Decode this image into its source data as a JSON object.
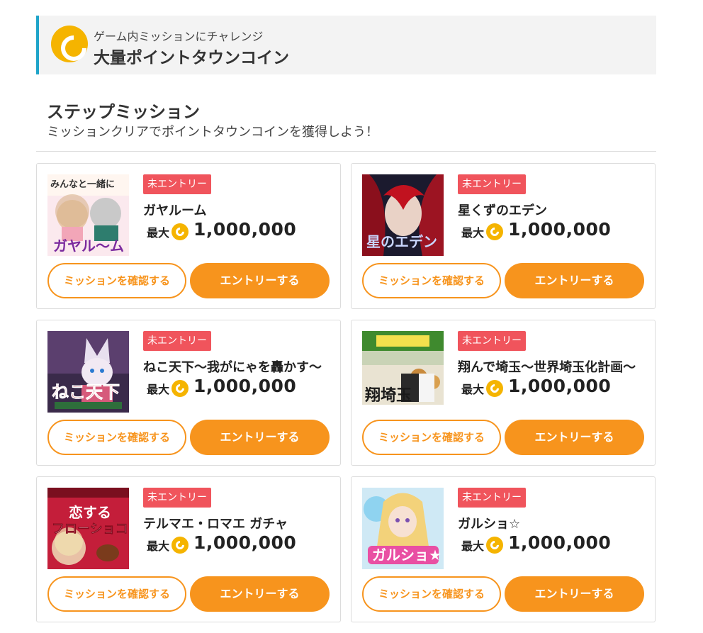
{
  "header": {
    "coin_icon": "coin-icon",
    "subtitle": "ゲーム内ミッションにチャレンジ",
    "title": "大量ポイントタウンコイン",
    "accent_color": "#1fa4c9"
  },
  "section": {
    "title": "ステップミッション",
    "subtitle": "ミッションクリアでポイントタウンコインを獲得しよう！"
  },
  "colors": {
    "badge": "#f0545c",
    "button": "#f7941d",
    "coin": "#f5b400"
  },
  "missions": [
    {
      "badge": "未エントリー",
      "title": "ガヤルーム",
      "max_label": "最大",
      "max_value": "1,000,000",
      "confirm_label": "ミッションを確認する",
      "entry_label": "エントリーする",
      "thumb_icon": "game-thumbnail"
    },
    {
      "badge": "未エントリー",
      "title": "星くずのエデン",
      "max_label": "最大",
      "max_value": "1,000,000",
      "confirm_label": "ミッションを確認する",
      "entry_label": "エントリーする",
      "thumb_icon": "game-thumbnail"
    },
    {
      "badge": "未エントリー",
      "title": "ねこ天下～我がにゃを轟かす～",
      "max_label": "最大",
      "max_value": "1,000,000",
      "confirm_label": "ミッションを確認する",
      "entry_label": "エントリーする",
      "thumb_icon": "game-thumbnail"
    },
    {
      "badge": "未エントリー",
      "title": "翔んで埼玉～世界埼玉化計画～",
      "max_label": "最大",
      "max_value": "1,000,000",
      "confirm_label": "ミッションを確認する",
      "entry_label": "エントリーする",
      "thumb_icon": "game-thumbnail"
    },
    {
      "badge": "未エントリー",
      "title": "テルマエ・ロマエ ガチャ",
      "max_label": "最大",
      "max_value": "1,000,000",
      "confirm_label": "ミッションを確認する",
      "entry_label": "エントリーする",
      "thumb_icon": "game-thumbnail"
    },
    {
      "badge": "未エントリー",
      "title": "ガルショ☆",
      "max_label": "最大",
      "max_value": "1,000,000",
      "confirm_label": "ミッションを確認する",
      "entry_label": "エントリーする",
      "thumb_icon": "game-thumbnail"
    }
  ]
}
